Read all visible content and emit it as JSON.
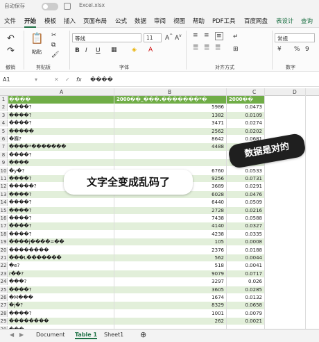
{
  "titlebar": {
    "autosave": "自动保存",
    "filename": "Excel.xlsx"
  },
  "menu": {
    "items": [
      "文件",
      "开始",
      "模板",
      "插入",
      "页面布局",
      "公式",
      "数据",
      "审阅",
      "视图",
      "帮助",
      "PDF工具",
      "百度网盘"
    ],
    "right_items": [
      "表设计",
      "查询"
    ],
    "active": "开始"
  },
  "ribbon": {
    "font_name": "等线",
    "font_size": "11",
    "group_labels": {
      "undo": "撤销",
      "clipboard": "剪贴板",
      "font": "字体",
      "alignment": "对齐方式",
      "number": "数字"
    },
    "paste_label": "粘贴",
    "number_format": "常规",
    "bold": "B",
    "italic": "I",
    "underline": "U"
  },
  "formula_bar": {
    "cell_ref": "A1",
    "fx": "fx",
    "value": "����"
  },
  "columns": [
    "A",
    "B",
    "C",
    "D"
  ],
  "header_row": {
    "a": "����",
    "b": "2000��_���.�������*�",
    "c": "2000��"
  },
  "rows": [
    {
      "n": "2",
      "a": "����?",
      "b": "5986",
      "c": "0.0473"
    },
    {
      "n": "3",
      "a": "����?",
      "b": "1382",
      "c": "0.0109"
    },
    {
      "n": "4",
      "a": "����?",
      "b": "3471",
      "c": "0.0274"
    },
    {
      "n": "5",
      "a": "�����",
      "b": "2562",
      "c": "0.0202"
    },
    {
      "n": "6",
      "a": "�赛?",
      "b": "8642",
      "c": "0.0681"
    },
    {
      "n": "7",
      "a": "        ����*�������",
      "b": "4488",
      "c": ""
    },
    {
      "n": "8",
      "a": "����?",
      "b": "",
      "c": ""
    },
    {
      "n": "9",
      "a": "����",
      "b": "",
      "c": ""
    },
    {
      "n": "10",
      "a": "�y�?",
      "b": "6760",
      "c": "0.0533"
    },
    {
      "n": "11",
      "a": "����?",
      "b": "9256",
      "c": "0.0731"
    },
    {
      "n": "12",
      "a": "�����?",
      "b": "3689",
      "c": "0.0291"
    },
    {
      "n": "13",
      "a": "����?",
      "b": "6028",
      "c": "0.0476"
    },
    {
      "n": "14",
      "a": "����?",
      "b": "6440",
      "c": "0.0509"
    },
    {
      "n": "15",
      "a": "����?",
      "b": "2728",
      "c": "0.0216"
    },
    {
      "n": "16",
      "a": "����?",
      "b": "7438",
      "c": "0.0588"
    },
    {
      "n": "17",
      "a": "����?",
      "b": "4140",
      "c": "0.0327"
    },
    {
      "n": "18",
      "a": "����?",
      "b": "4238",
      "c": "0.0335"
    },
    {
      "n": "19",
      "a": "����j����=��",
      "b": "105",
      "c": "0.0008"
    },
    {
      "n": "20",
      "a": "��������",
      "b": "2376",
      "c": "0.0188"
    },
    {
      "n": "21",
      "a": "���L�������",
      "b": "562",
      "c": "0.0044"
    },
    {
      "n": "22",
      "a": "�e?",
      "b": "518",
      "c": "0.0041"
    },
    {
      "n": "23",
      "a": "r��?",
      "b": "9079",
      "c": "0.0717"
    },
    {
      "n": "24",
      "a": "���?",
      "b": "3297",
      "c": "0.026"
    },
    {
      "n": "25",
      "a": "����?",
      "b": "3605",
      "c": "0.0285"
    },
    {
      "n": "26",
      "a": "�M���",
      "b": "1674",
      "c": "0.0132"
    },
    {
      "n": "27",
      "a": "�j�?",
      "b": "8329",
      "c": "0.0658"
    },
    {
      "n": "28",
      "a": "����?",
      "b": "1001",
      "c": "0.0079"
    },
    {
      "n": "29",
      "a": "��������",
      "b": "262",
      "c": "0.0021"
    },
    {
      "n": "30",
      "a": "���",
      "b": "",
      "c": ""
    }
  ],
  "sheet_tabs": [
    "Document",
    "Table 1",
    "Sheet1"
  ],
  "selected_tab": "Table 1",
  "annotations": {
    "garbled_text": "文字全变成乱码了",
    "data_ok": "数据是对的"
  },
  "colors": {
    "accent": "#1e7145",
    "header_fill": "#70ad47",
    "band_fill": "#e2efda"
  }
}
